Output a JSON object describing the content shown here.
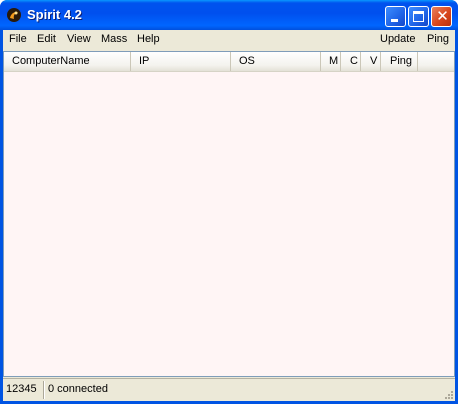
{
  "window": {
    "title": "Spirit 4.2",
    "icon": "spirit-app-icon",
    "controls": [
      "minimize-icon",
      "maximize-icon",
      "close-icon"
    ]
  },
  "menu": {
    "file": "File",
    "edit": "Edit",
    "view": "View",
    "mass": "Mass",
    "help": "Help",
    "update": "Update",
    "ping": "Ping"
  },
  "list": {
    "columns": [
      "ComputerName",
      "IP",
      "OS",
      "M",
      "C",
      "V",
      "Ping"
    ],
    "rows": []
  },
  "status": {
    "port": "12345",
    "connections": "0 connected"
  },
  "colors": {
    "titlebar": "#0054e3",
    "list_background": "#fff5f5",
    "chrome": "#ece9d8"
  }
}
